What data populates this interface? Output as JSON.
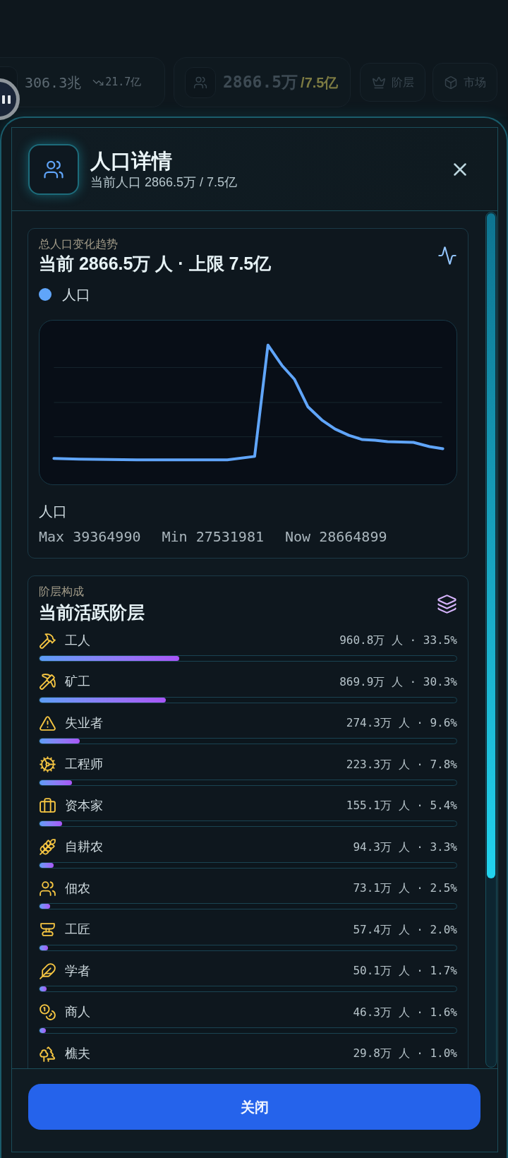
{
  "top_bar": {
    "treasury": {
      "amount": "306.3兆",
      "change": "21.7亿"
    },
    "population": {
      "amount": "2866.5万",
      "cap": "/7.5亿"
    },
    "buttons": [
      {
        "kind": "classes",
        "label": "阶层"
      },
      {
        "kind": "market",
        "label": "市场"
      }
    ]
  },
  "dialog": {
    "title": "人口详情",
    "subtitle": "当前人口 2866.5万 / 7.5亿"
  },
  "trend_card": {
    "label": "总人口变化趋势",
    "heading": "当前 2866.5万 人 · 上限 7.5亿",
    "legend": "人口",
    "series_label": "人口",
    "stats": [
      "Max 39364990",
      "Min 27531981",
      "Now 28664899"
    ]
  },
  "class_card": {
    "label": "阶层构成",
    "heading": "当前活跃阶层",
    "classes": [
      {
        "kind": "worker",
        "name": "工人",
        "reading": "960.8万 人 · 33.5%",
        "level": 0.335
      },
      {
        "kind": "miner",
        "name": "矿工",
        "reading": "869.9万 人 · 30.3%",
        "level": 0.303
      },
      {
        "kind": "unemployed",
        "name": "失业者",
        "reading": "274.3万 人 · 9.6%",
        "level": 0.096
      },
      {
        "kind": "engineer",
        "name": "工程师",
        "reading": "223.3万 人 · 7.8%",
        "level": 0.078
      },
      {
        "kind": "capitalist",
        "name": "资本家",
        "reading": "155.1万 人 · 5.4%",
        "level": 0.054
      },
      {
        "kind": "farmer",
        "name": "自耕农",
        "reading": "94.3万 人 · 3.3%",
        "level": 0.033
      },
      {
        "kind": "tenant",
        "name": "佃农",
        "reading": "73.1万 人 · 2.5%",
        "level": 0.025
      },
      {
        "kind": "artisan",
        "name": "工匠",
        "reading": "57.4万 人 · 2.0%",
        "level": 0.02
      },
      {
        "kind": "scholar",
        "name": "学者",
        "reading": "50.1万 人 · 1.7%",
        "level": 0.017
      },
      {
        "kind": "merchant",
        "name": "商人",
        "reading": "46.3万 人 · 1.6%",
        "level": 0.016
      },
      {
        "kind": "woodcutter",
        "name": "樵夫",
        "reading": "29.8万 人 · 1.0%"
      }
    ]
  },
  "footer": {
    "close_button": "关闭"
  }
}
